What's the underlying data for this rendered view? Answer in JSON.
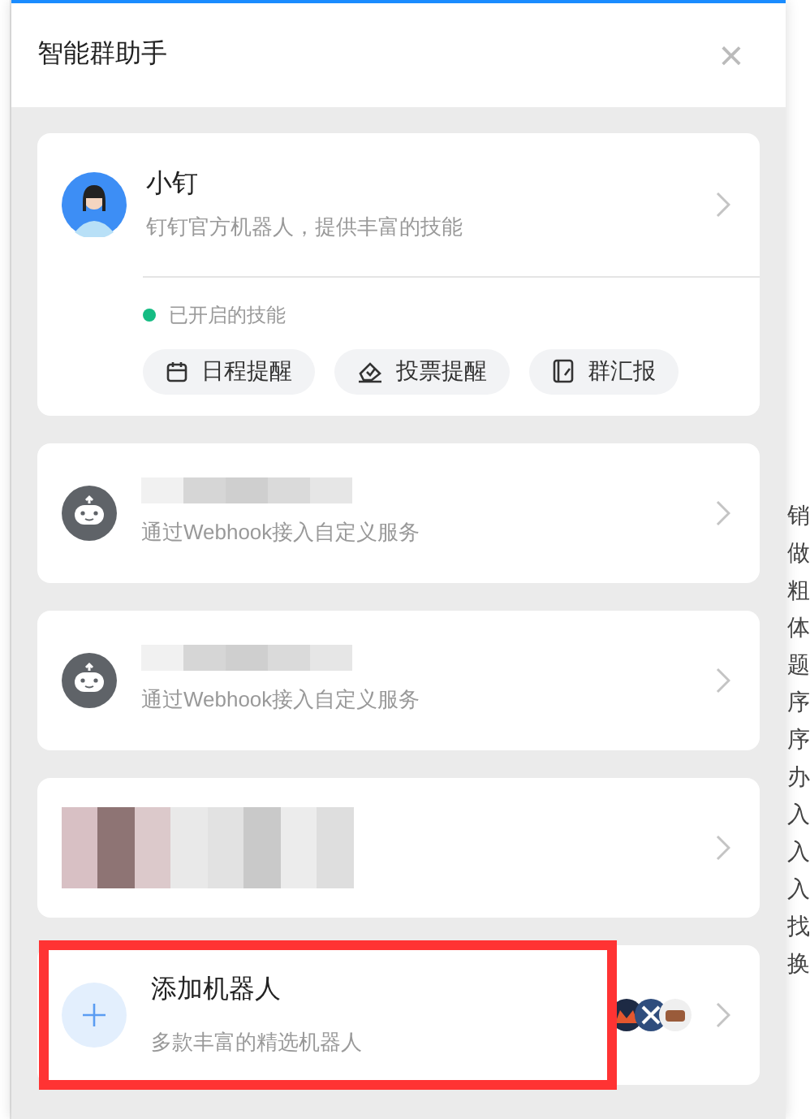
{
  "panel": {
    "title": "智能群助手",
    "close": "×"
  },
  "featured": {
    "name": "小钉",
    "description": "钉钉官方机器人，提供丰富的技能",
    "skills_label": "已开启的技能",
    "skills": [
      {
        "kind": "calendar",
        "label": "日程提醒"
      },
      {
        "kind": "vote",
        "label": "投票提醒"
      },
      {
        "kind": "report",
        "label": "群汇报"
      }
    ]
  },
  "robots": [
    {
      "kind": "webhook",
      "description": "通过Webhook接入自定义服务"
    },
    {
      "kind": "webhook",
      "description": "通过Webhook接入自定义服务"
    },
    {
      "kind": "blurred"
    }
  ],
  "add_robot": {
    "title": "添加机器人",
    "description": "多款丰富的精选机器人",
    "highlighted": true
  },
  "background_page": {
    "lines": [
      "销",
      "做",
      "粗",
      "体",
      "题",
      "序",
      "序",
      "办",
      "入",
      "入",
      "入",
      "找",
      "换"
    ]
  }
}
